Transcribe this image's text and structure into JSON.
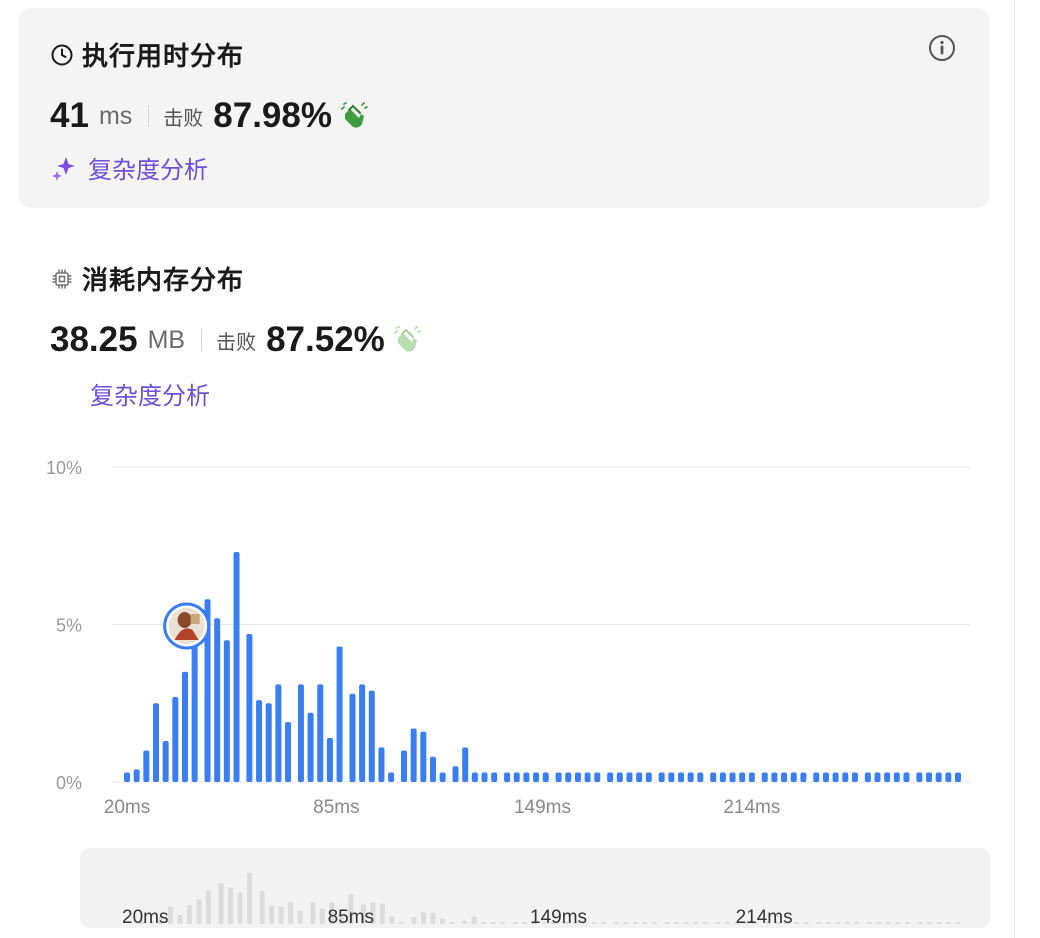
{
  "runtime": {
    "title": "执行用时分布",
    "value": "41",
    "unit": "ms",
    "beat_label": "击败",
    "beat_percent": "87.98%",
    "complexity_label": "复杂度分析",
    "icon": "clock-icon",
    "info_icon": "info-icon",
    "clap_color": "#3f9b3f"
  },
  "memory": {
    "title": "消耗内存分布",
    "value": "38.25",
    "unit": "MB",
    "beat_label": "击败",
    "beat_percent": "87.52%",
    "complexity_label": "复杂度分析",
    "icon": "chip-icon",
    "clap_color": "#b8ddb0"
  },
  "colors": {
    "bar": "#3a7ef3",
    "bar_muted": "#dcdcdc",
    "accent_purple": "#6d4fd8",
    "grid": "#e6e6e6"
  },
  "chart_data": {
    "type": "bar",
    "y_ticks": [
      "10%",
      "5%",
      "0%"
    ],
    "ylim": [
      0,
      10
    ],
    "x_tick_labels": [
      "20ms",
      "85ms",
      "149ms",
      "214ms"
    ],
    "x_tick_values": [
      20,
      85,
      149,
      214
    ],
    "current_marker": {
      "x": 41,
      "label": "avatar"
    },
    "x": [
      20,
      23,
      26,
      29,
      32,
      35,
      38,
      41,
      45,
      48,
      51,
      54,
      58,
      61,
      64,
      67,
      70,
      74,
      77,
      80,
      83,
      86,
      90,
      93,
      96,
      99,
      102,
      106,
      109,
      112,
      115,
      118,
      122,
      125,
      128,
      131,
      134,
      138,
      141,
      144,
      147,
      150,
      154,
      157,
      160,
      163,
      166,
      170,
      173,
      176,
      179,
      182,
      186,
      189,
      192,
      195,
      198,
      202,
      205,
      208,
      211,
      214,
      218,
      221,
      224,
      227,
      230,
      234,
      237,
      240,
      243,
      246,
      250,
      253,
      256,
      259,
      262,
      266,
      269,
      272,
      275,
      278
    ],
    "values": [
      0.3,
      0.4,
      1.0,
      2.5,
      1.3,
      2.7,
      3.5,
      4.8,
      5.8,
      5.2,
      4.5,
      7.3,
      4.7,
      2.6,
      2.5,
      3.1,
      1.9,
      3.1,
      2.2,
      3.1,
      1.4,
      4.3,
      2.8,
      3.1,
      2.9,
      1.1,
      0.3,
      1.0,
      1.7,
      1.6,
      0.8,
      0.3,
      0.5,
      1.1,
      0.3,
      0.3,
      0.3,
      0.3,
      0.3,
      0.3,
      0.3,
      0.3,
      0.3,
      0.3,
      0.3,
      0.3,
      0.3,
      0.3,
      0.3,
      0.3,
      0.3,
      0.3,
      0.3,
      0.3,
      0.3,
      0.3,
      0.3,
      0.3,
      0.3,
      0.3,
      0.3,
      0.3,
      0.3,
      0.3,
      0.3,
      0.3,
      0.3,
      0.3,
      0.3,
      0.3,
      0.3,
      0.3,
      0.3,
      0.3,
      0.3,
      0.3,
      0.3,
      0.3,
      0.3,
      0.3,
      0.3,
      0.3
    ]
  },
  "overview_chart": {
    "x_tick_labels": [
      "20ms",
      "85ms",
      "149ms",
      "214ms"
    ]
  }
}
